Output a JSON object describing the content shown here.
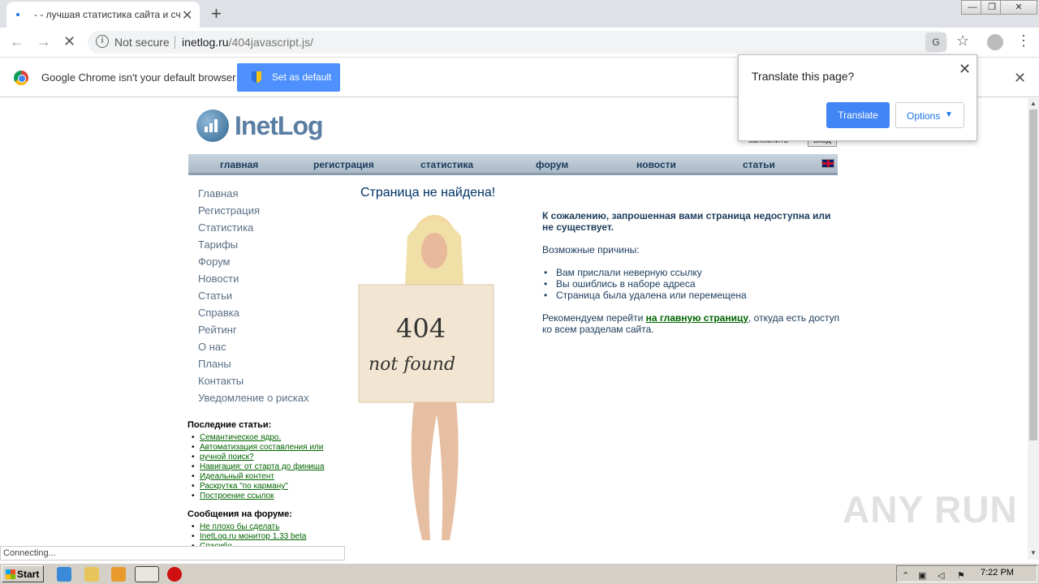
{
  "browser": {
    "tab_title": "- - лучшая статистика сайта и сче",
    "url_host": "inetlog.ru",
    "url_path": "/404javascript.js/",
    "not_secure": "Not secure",
    "status": "Connecting..."
  },
  "infobar": {
    "text": "Google Chrome isn't your default browser",
    "button": "Set as default"
  },
  "translate_popup": {
    "title": "Translate this page?",
    "translate_button": "Translate",
    "options_button": "Options"
  },
  "site": {
    "logo": "InetLog",
    "remember": "запомнить",
    "login": "вход",
    "topnav": [
      "главная",
      "регистрация",
      "статистика",
      "форум",
      "новости",
      "статьи"
    ],
    "sidenav": [
      "Главная",
      "Регистрация",
      "Статистика",
      "Тарифы",
      "Форум",
      "Новости",
      "Статьи",
      "Справка",
      "Рейтинг",
      "О нас",
      "Планы",
      "Контакты",
      "Уведомление о рисках"
    ],
    "articles_title": "Последние статьи:",
    "articles": [
      "Семантическое ядро.",
      "Автоматизация составления или",
      "ручной поиск?",
      "Навигация: от старта до финиша",
      "Идеальный контент",
      "Раскрутка \"по карману\"",
      "Построение ссылок"
    ],
    "forum_title": "Сообщения на форуме:",
    "forum": [
      "Не плохо бы сделать",
      "InetLog.ru монитор 1.33 beta",
      "Спасибо"
    ],
    "heading": "Страница не найдена!",
    "image_text_1": "404",
    "image_text_2": "not found",
    "msg_bold": "К сожалению, запрошенная вами страница недоступна или не существует.",
    "reasons_title": "Возможные причины:",
    "reasons": [
      "Вам прислали неверную ссылку",
      "Вы ошиблись в наборе адреса",
      "Страница была удалена или перемещена"
    ],
    "recommend_before": "Рекомендуем перейти ",
    "recommend_link": "на главную страницу",
    "recommend_after": ", откуда есть доступ ко всем разделам сайта."
  },
  "watermark": "ANY RUN",
  "taskbar": {
    "start": "Start",
    "clock": "7:22 PM"
  }
}
